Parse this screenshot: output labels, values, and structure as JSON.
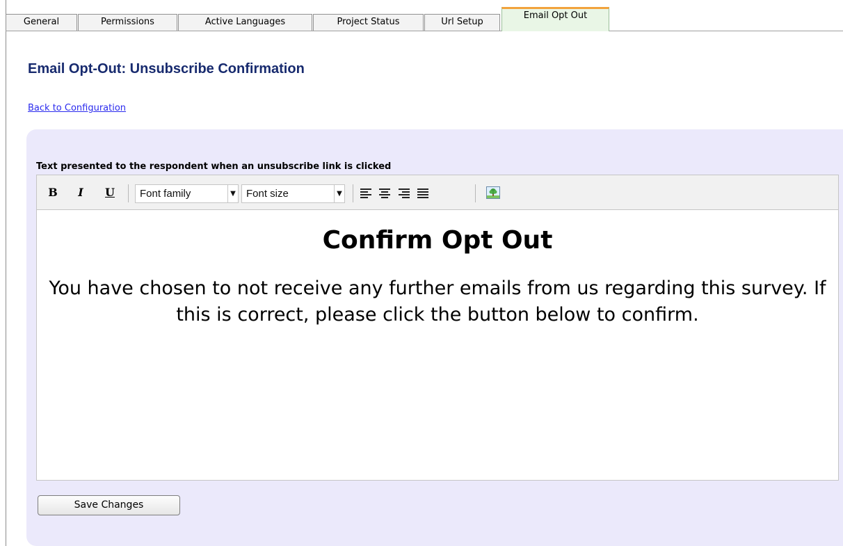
{
  "tabs": [
    {
      "label": "General",
      "active": false
    },
    {
      "label": "Permissions",
      "active": false
    },
    {
      "label": "Active Languages",
      "active": false
    },
    {
      "label": "Project Status",
      "active": false
    },
    {
      "label": "Url Setup",
      "active": false
    },
    {
      "label": "Email Opt Out",
      "active": true
    }
  ],
  "page": {
    "title": "Email Opt-Out: Unsubscribe Confirmation",
    "back_link": "Back to Configuration"
  },
  "editor": {
    "field_label": "Text presented to the respondent when an unsubscribe link is clicked",
    "toolbar": {
      "bold": "B",
      "italic": "I",
      "underline": "U",
      "font_family": "Font family",
      "font_size": "Font size"
    },
    "content": {
      "heading": "Confirm Opt Out",
      "body": "You have chosen to not receive any further emails from us regarding this survey. If this is correct, please click the button below to confirm."
    }
  },
  "actions": {
    "save_label": "Save Changes"
  },
  "icons": {
    "align_left": "align-left-icon",
    "align_center": "align-center-icon",
    "align_right": "align-right-icon",
    "align_justify": "align-justify-icon",
    "insert_image": "insert-image-icon"
  },
  "colors": {
    "title": "#172a6e",
    "link": "#2a2aee",
    "panel": "#ebe9fb",
    "active_tab": "#e9f6e6",
    "active_tab_accent": "#f2a33c"
  }
}
